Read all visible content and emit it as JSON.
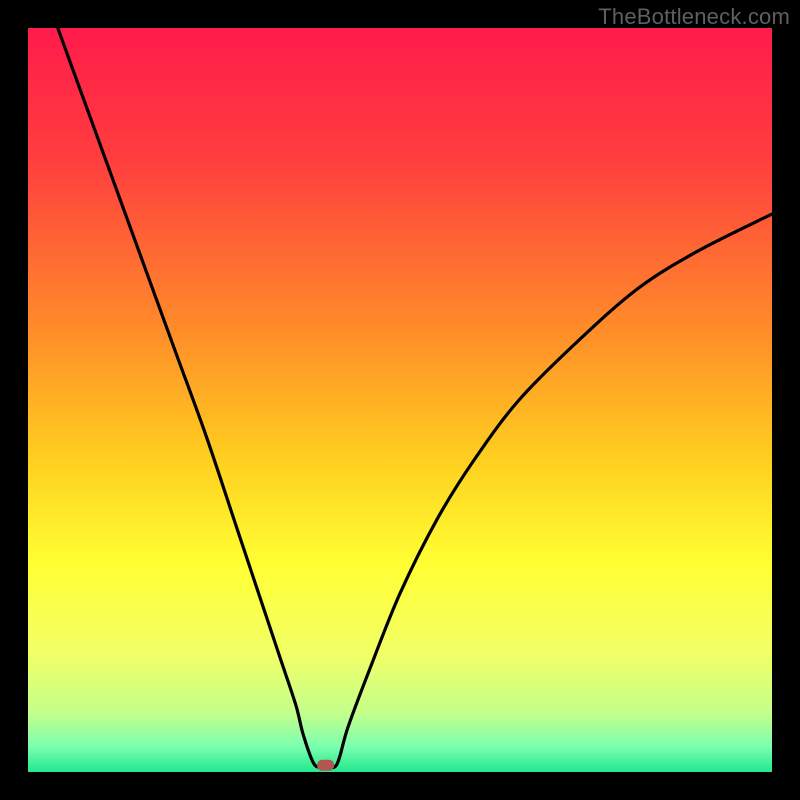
{
  "watermark": "TheBottleneck.com",
  "chart_data": {
    "type": "line",
    "title": "",
    "xlabel": "",
    "ylabel": "",
    "xlim": [
      0,
      100
    ],
    "ylim": [
      0,
      100
    ],
    "series": [
      {
        "name": "curve",
        "x": [
          4,
          8,
          12,
          16,
          20,
          24,
          28,
          30,
          32,
          34,
          36,
          37,
          38.5,
          40,
          41.5,
          43,
          46,
          50,
          55,
          60,
          66,
          74,
          82,
          90,
          100
        ],
        "values": [
          100,
          89,
          78,
          67,
          56,
          45,
          33,
          27,
          21,
          15,
          9,
          5,
          1,
          0.9,
          1,
          6,
          14,
          24,
          34,
          42,
          50,
          58,
          65,
          70,
          75
        ]
      }
    ],
    "marker": {
      "x": 40,
      "y": 0.9,
      "color": "#b3564f"
    },
    "gradient_stops": [
      {
        "offset": 0.0,
        "color": "#ff1b4b"
      },
      {
        "offset": 0.18,
        "color": "#ff3f3e"
      },
      {
        "offset": 0.4,
        "color": "#ff8a2a"
      },
      {
        "offset": 0.58,
        "color": "#ffcf1f"
      },
      {
        "offset": 0.72,
        "color": "#ffff33"
      },
      {
        "offset": 0.84,
        "color": "#f2ff66"
      },
      {
        "offset": 0.92,
        "color": "#c4ff8a"
      },
      {
        "offset": 0.965,
        "color": "#7dffaf"
      },
      {
        "offset": 1.0,
        "color": "#23e78f"
      }
    ]
  }
}
